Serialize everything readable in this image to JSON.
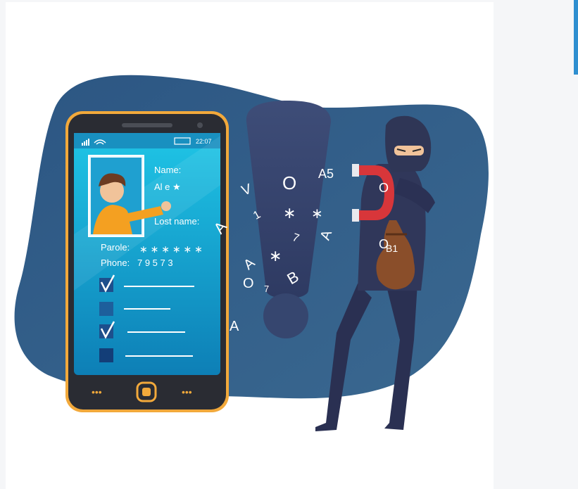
{
  "phone": {
    "status_time": "22:07",
    "name_label": "Name:",
    "name_value": "Al e  ★",
    "lastname_label": "Lost name:",
    "parole_label": "Parole:",
    "parole_value": "∗ ∗ ∗  ∗   ∗  ∗",
    "phone_label": "Phone:",
    "phone_value": "7  9  5     7    3",
    "nav_left": "•••",
    "nav_right": "•••"
  },
  "floating": {
    "t1": "V",
    "t2": "O",
    "t3": "A5",
    "t4": "1",
    "t5": "∗",
    "t6": "∗",
    "t7": "A",
    "t8": "7",
    "t9": "A",
    "t10": "∗",
    "t11": "A",
    "t12": "O",
    "t13": "7",
    "t14": "B",
    "t15": "A",
    "t16": "O",
    "t17": "O",
    "t18": "B1"
  },
  "colors": {
    "blob": "#2e557d",
    "phone_frame": "#f2a93b",
    "phone_body": "#2a2c33",
    "screen": "#1aa6d4",
    "exclamation": "#36466f",
    "hacker": "#2f3656",
    "magnet": "#d8363a",
    "bag": "#8a4e2a"
  }
}
